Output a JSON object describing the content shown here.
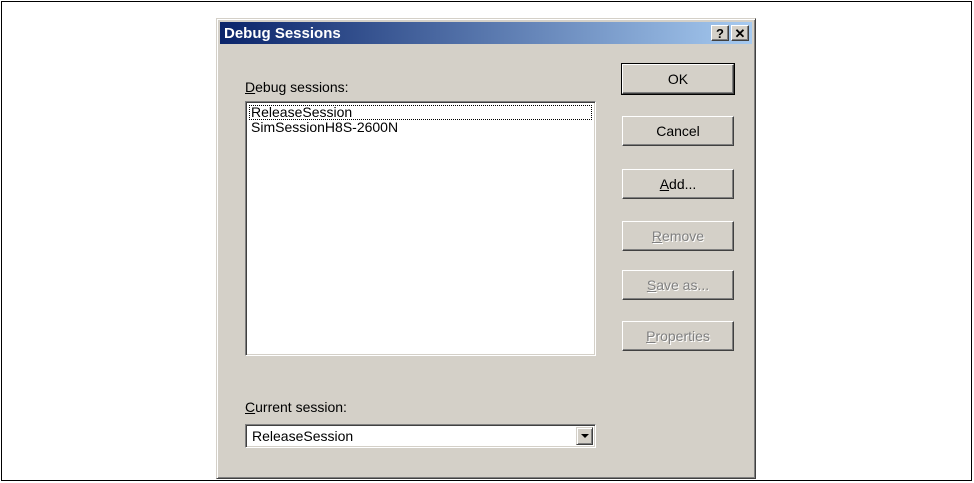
{
  "dialog": {
    "title": "Debug Sessions",
    "help_button": "?",
    "close_button": "✕"
  },
  "sessions": {
    "label_accesskey": "D",
    "label_rest": "ebug sessions:",
    "items": [
      "ReleaseSession",
      "SimSessionH8S-2600N"
    ],
    "focused_index": 0
  },
  "buttons": {
    "ok": "OK",
    "cancel": "Cancel",
    "add_accesskey": "A",
    "add_rest": "dd...",
    "remove_accesskey": "R",
    "remove_rest": "emove",
    "save_accesskey": "S",
    "save_rest": "ave as...",
    "properties_accesskey": "P",
    "properties_rest": "roperties"
  },
  "current": {
    "label_accesskey": "C",
    "label_rest": "urrent session:",
    "value": "ReleaseSession"
  }
}
